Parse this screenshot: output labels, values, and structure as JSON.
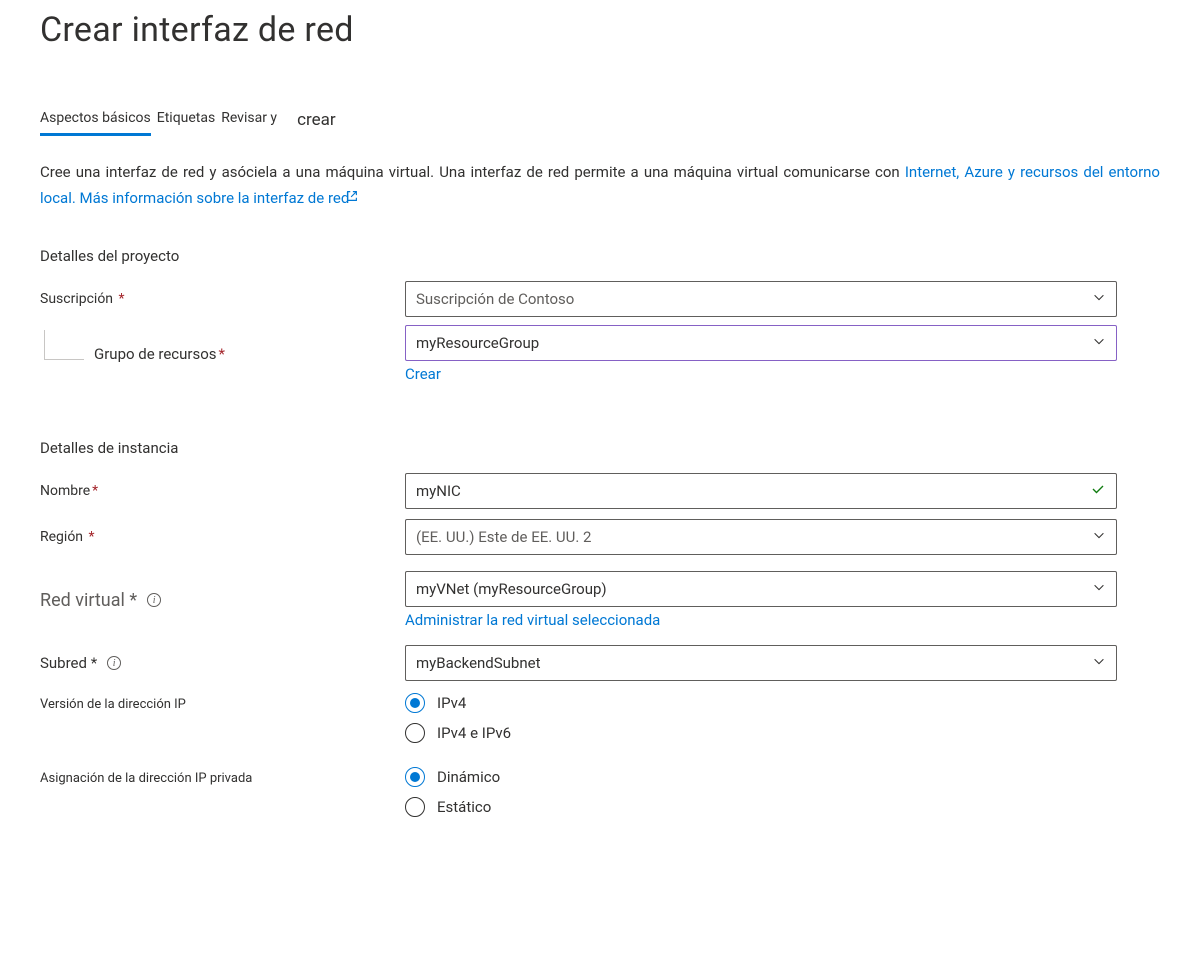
{
  "page_title": "Crear interfaz de red",
  "tabs": {
    "basics": "Aspectos básicos",
    "tags": "Etiquetas",
    "review": "Revisar y",
    "create": "crear"
  },
  "intro": {
    "text1": "Cree una interfaz de red y asóciela a una máquina virtual. Una interfaz de red permite a una máquina virtual comunicarse con ",
    "text2": "Internet, Azure y recursos del entorno local. ",
    "link": "Más información sobre la interfaz de red"
  },
  "sections": {
    "project_details": "Detalles del proyecto",
    "instance_details": "Detalles de instancia"
  },
  "fields": {
    "subscription": {
      "label": "Suscripción",
      "value": "Suscripción de Contoso"
    },
    "resource_group": {
      "label": "Grupo de recursos",
      "value": "myResourceGroup",
      "create_link": "Crear"
    },
    "name": {
      "label": "Nombre",
      "value": "myNIC"
    },
    "region": {
      "label": "Región",
      "value": "(EE. UU.) Este de EE. UU. 2"
    },
    "vnet": {
      "label": "Red virtual",
      "value": "myVNet (myResourceGroup)",
      "sublink": "Administrar la red virtual seleccionada"
    },
    "subnet": {
      "label": "Subred",
      "value": "myBackendSubnet"
    },
    "ip_version": {
      "label": "Versión de la dirección IP",
      "opt1": "IPv4",
      "opt2": "IPv4 e IPv6"
    },
    "ip_assignment": {
      "label": "Asignación de la dirección IP privada",
      "opt1": "Dinámico",
      "opt2": "Estático"
    }
  }
}
